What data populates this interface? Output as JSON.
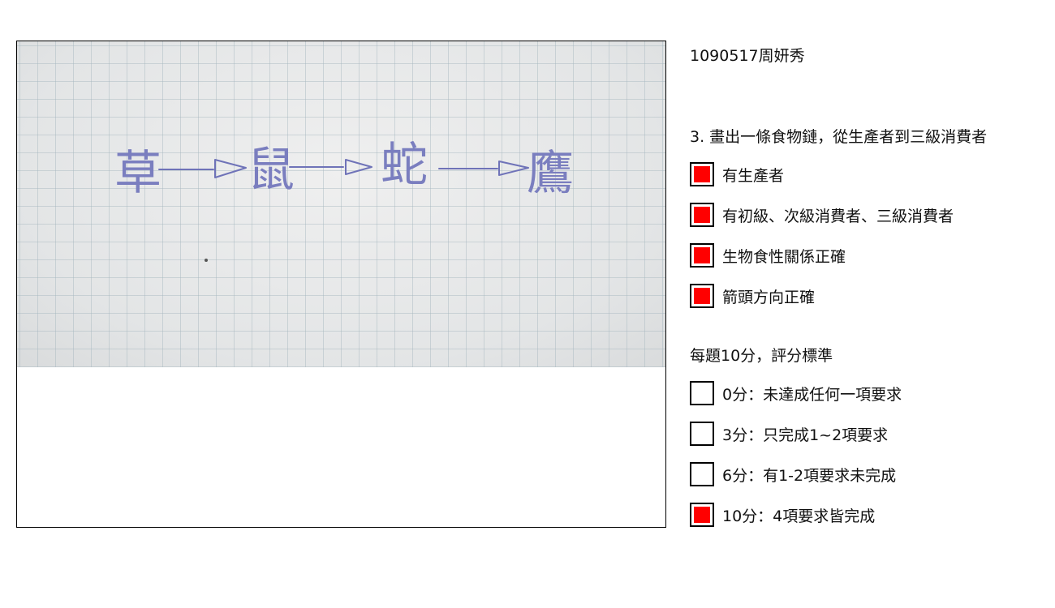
{
  "photo": {
    "handwriting": [
      "草",
      "鼠",
      "蛇",
      "鷹"
    ]
  },
  "student_id": "1090517周妍秀",
  "question": "3. 畫出一條食物鏈，從生產者到三級消費者",
  "requirements": [
    {
      "label": "有生產者",
      "checked": true
    },
    {
      "label": "有初級、次級消費者、三級消費者",
      "checked": true
    },
    {
      "label": "生物食性關係正確",
      "checked": true
    },
    {
      "label": "箭頭方向正確",
      "checked": true
    }
  ],
  "rubric_title": "每題10分，評分標準",
  "scores": [
    {
      "label": "0分：未達成任何一項要求",
      "checked": false
    },
    {
      "label": "3分：只完成1~2項要求",
      "checked": false
    },
    {
      "label": "6分：有1-2項要求未完成",
      "checked": false
    },
    {
      "label": "10分：4項要求皆完成",
      "checked": true
    }
  ],
  "colors": {
    "check_fill": "#ff0000",
    "ink": "#6f73b8",
    "grid": "#a5b6be"
  }
}
